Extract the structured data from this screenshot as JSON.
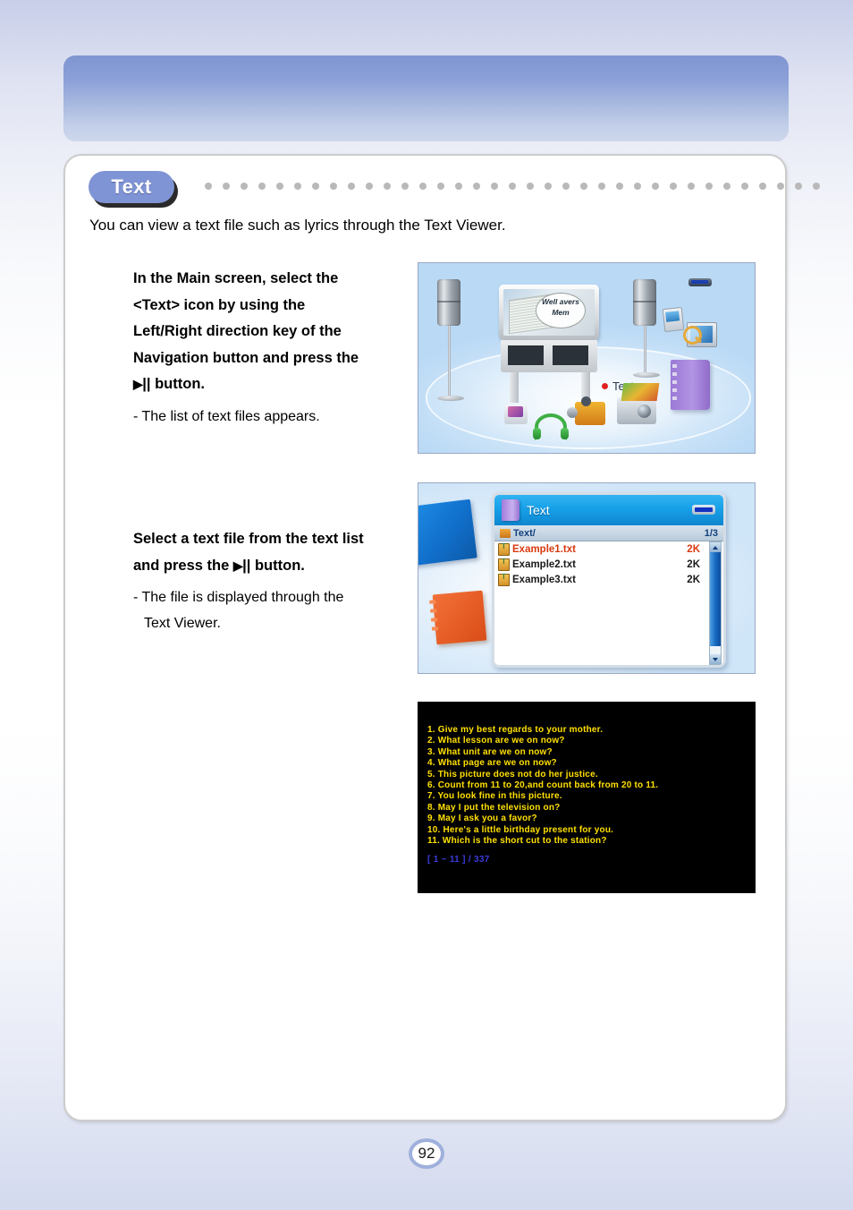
{
  "page": {
    "number": "92"
  },
  "section": {
    "tab_label": "Text",
    "dot_count": 35,
    "intro": "You can view a text file such as lyrics through the Text Viewer."
  },
  "steps": [
    {
      "title_lines": [
        "In the Main screen, select the",
        "<Text> icon by using the",
        "Left/Right direction key of the",
        "Navigation button and press the"
      ],
      "title_last_prefix": "",
      "title_last_suffix": "|| button.",
      "play_symbol": "▶",
      "note_lines": [
        "- The list of text files appears."
      ]
    },
    {
      "title_lines": [
        "Select a text file from the text list"
      ],
      "title_last_prefix": "and press the ",
      "title_last_suffix": "|| button.",
      "play_symbol": "▶",
      "note_lines": [
        "- The file is displayed through the",
        "Text Viewer."
      ]
    }
  ],
  "shot_main_menu": {
    "label": "Text",
    "tv_screen_text": "Well avers Mem",
    "icons": [
      "speaker-left-icon",
      "speaker-right-icon",
      "tv-icon",
      "battery-icon",
      "photo-icon",
      "browser-icon",
      "magnifier-icon",
      "text-book-icon",
      "game-icon",
      "headphone-icon",
      "camcorder-icon",
      "digital-camera-icon"
    ]
  },
  "shot_file_list": {
    "title": "Text",
    "path": "Text/",
    "page_indicator": "1/3",
    "columns": [
      "name",
      "size"
    ],
    "rows": [
      {
        "name": "Example1.txt",
        "size": "2K",
        "selected": true
      },
      {
        "name": "Example2.txt",
        "size": "2K",
        "selected": false
      },
      {
        "name": "Example3.txt",
        "size": "2K",
        "selected": false
      }
    ]
  },
  "shot_text_viewer": {
    "lines": [
      "1. Give my best regards to your mother.",
      "2. What lesson are we on now?",
      "3. What unit are we on now?",
      "4. What page are we on now?",
      "5. This picture does not do her justice.",
      "6. Count from 11 to 20,and count back from 20 to 11.",
      "7. You look fine in this picture.",
      "8. May I put the television on?",
      "9. May I ask you a favor?",
      "10. Here's a little birthday present for you.",
      "11. Which is the short cut to the station?"
    ],
    "status": "[ 1 ~ 11 ] / 337"
  },
  "colors": {
    "accent": "#7f94d4",
    "header_gradient_top": "#7f95d1",
    "header_gradient_bottom": "#cdd7ec",
    "viewer_text": "#ffe000",
    "viewer_status": "#3b3bdd",
    "selected_row": "#d83a10"
  }
}
